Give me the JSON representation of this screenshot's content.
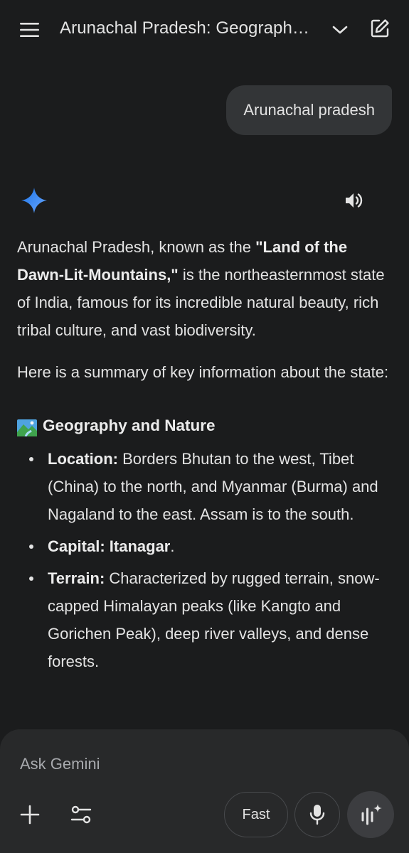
{
  "header": {
    "title": "Arunachal Pradesh: Geograph…",
    "icons": [
      "menu-icon",
      "chevron-down-icon",
      "new-chat-icon"
    ]
  },
  "user_message": "Arunachal pradesh",
  "response": {
    "intro_prefix": "Arunachal Pradesh, known as the ",
    "intro_bold": "\"Land of the Dawn-Lit-Mountains,\"",
    "intro_suffix": " is the northeasternmost state of India, famous for its incredible natural beauty, rich tribal culture, and vast biodiversity.",
    "summary_line": "Here is a summary of key information about the state:",
    "section_title": "Geography and Nature",
    "bullets": [
      {
        "label": "Location:",
        "text": " Borders Bhutan to the west, Tibet (China) to the north, and Myanmar (Burma) and Nagaland to the east. Assam is to the south."
      },
      {
        "label": "Capital: Itanagar",
        "text": "."
      },
      {
        "label": "Terrain:",
        "text": " Characterized by rugged terrain, snow-capped Himalayan peaks (like Kangto and Gorichen Peak), deep river valleys, and dense forests."
      }
    ]
  },
  "input": {
    "placeholder": "Ask Gemini",
    "mode_label": "Fast"
  },
  "colors": {
    "background": "#1b1c1d",
    "bubble": "#333537",
    "panel": "#28292a",
    "gemini_blue": "#4285f4"
  }
}
